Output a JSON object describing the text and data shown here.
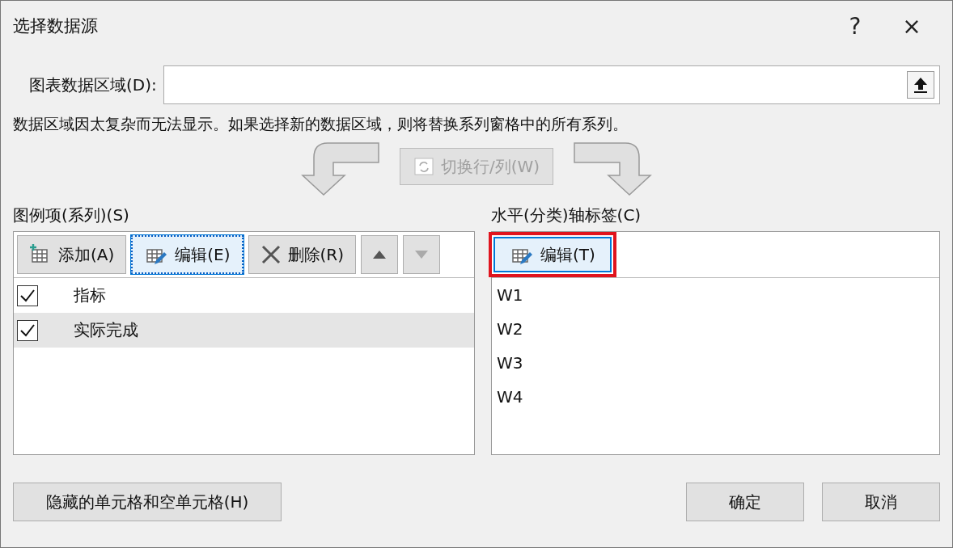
{
  "window": {
    "title": "选择数据源",
    "help": "?",
    "close": "×"
  },
  "data_range": {
    "label": "图表数据区域(D):"
  },
  "message": "数据区域因太复杂而无法显示。如果选择新的数据区域，则将替换系列窗格中的所有系列。",
  "switch_button": {
    "label": "切换行/列(W)",
    "disabled": true
  },
  "series_panel": {
    "title": "图例项(系列)(S)",
    "buttons": [
      {
        "label": "添加(A)",
        "kind": "add",
        "focused": false
      },
      {
        "label": "编辑(E)",
        "kind": "edit",
        "focused": true
      },
      {
        "label": "删除(R)",
        "kind": "delete",
        "focused": false
      }
    ],
    "move_up": {
      "disabled": false
    },
    "move_down": {
      "disabled": true
    },
    "items": [
      {
        "label": "指标",
        "checked": true,
        "selected": false
      },
      {
        "label": "实际完成",
        "checked": true,
        "selected": true
      }
    ]
  },
  "axis_panel": {
    "title": "水平(分类)轴标签(C)",
    "edit_button": {
      "label": "编辑(T)",
      "highlighted": true
    },
    "items": [
      "W1",
      "W2",
      "W3",
      "W4"
    ]
  },
  "footer": {
    "hidden_cells_button": "隐藏的单元格和空单元格(H)",
    "ok": "确定",
    "cancel": "取消"
  }
}
